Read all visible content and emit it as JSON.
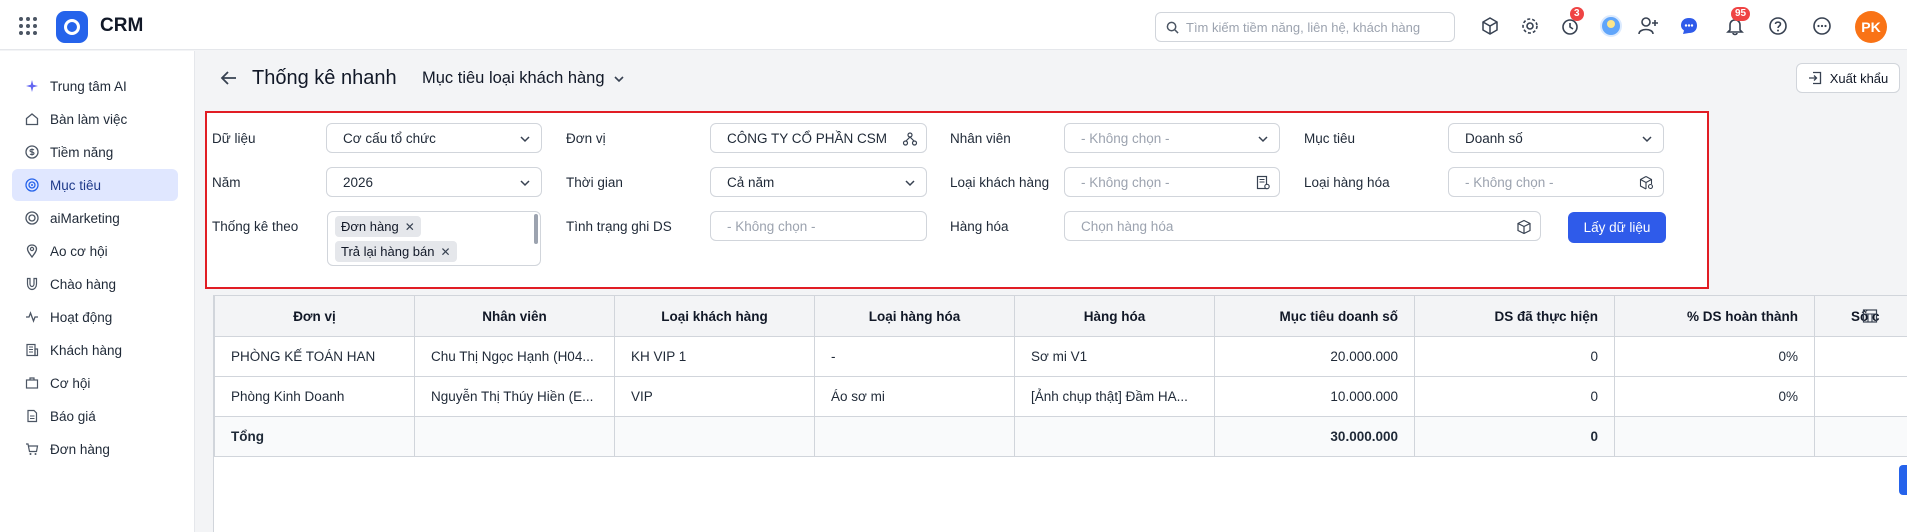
{
  "app": {
    "name": "CRM"
  },
  "search": {
    "placeholder": "Tìm kiếm tiềm năng, liên hệ, khách hàng"
  },
  "topbar": {
    "reminder_badge": "3",
    "notification_badge": "95",
    "user_initials": "PK"
  },
  "sidebar": {
    "items": [
      {
        "label": "Trung tâm AI",
        "icon": "sparkle-icon"
      },
      {
        "label": "Bàn làm việc",
        "icon": "home-icon"
      },
      {
        "label": "Tiềm năng",
        "icon": "dollar-icon"
      },
      {
        "label": "Mục tiêu",
        "icon": "target-icon",
        "active": true
      },
      {
        "label": "aiMarketing",
        "icon": "target-ring-icon"
      },
      {
        "label": "Ao cơ hội",
        "icon": "pin-icon"
      },
      {
        "label": "Chào hàng",
        "icon": "magnet-icon"
      },
      {
        "label": "Hoạt động",
        "icon": "activity-icon"
      },
      {
        "label": "Khách hàng",
        "icon": "building-icon"
      },
      {
        "label": "Cơ hội",
        "icon": "briefcase-icon"
      },
      {
        "label": "Báo giá",
        "icon": "document-icon"
      },
      {
        "label": "Đơn hàng",
        "icon": "cart-icon"
      }
    ]
  },
  "header": {
    "title": "Thống kê nhanh",
    "report_select": "Mục tiêu loại khách hàng",
    "export_label": "Xuất khẩu"
  },
  "filters": {
    "data_label": "Dữ liệu",
    "data_value": "Cơ cấu tổ chức",
    "unit_label": "Đơn vị",
    "unit_value": "CÔNG TY CỔ PHẦN CSM",
    "employee_label": "Nhân viên",
    "employee_placeholder": "- Không chọn -",
    "target_label": "Mục tiêu",
    "target_value": "Doanh số",
    "year_label": "Năm",
    "year_value": "2026",
    "time_label": "Thời gian",
    "time_value": "Cả năm",
    "customer_type_label": "Loại khách hàng",
    "customer_type_placeholder": "- Không chọn -",
    "product_type_label": "Loại hàng hóa",
    "product_type_placeholder": "- Không chọn -",
    "stat_by_label": "Thống kê theo",
    "stat_by_tags": [
      "Đơn hàng",
      "Trả lại hàng bán"
    ],
    "record_status_label": "Tình trạng ghi DS",
    "record_status_placeholder": "- Không chọn -",
    "product_label": "Hàng hóa",
    "product_placeholder": "Chọn hàng hóa",
    "get_data_label": "Lấy dữ liệu"
  },
  "table": {
    "columns": [
      "Đơn vị",
      "Nhân viên",
      "Loại khách hàng",
      "Loại hàng hóa",
      "Hàng hóa",
      "Mục tiêu doanh số",
      "DS đã thực hiện",
      "% DS hoàn thành",
      "Số c"
    ],
    "rows": [
      [
        "PHÒNG KẾ TOÁN HAN",
        "Chu Thị Ngọc Hạnh (H04...",
        "KH VIP 1",
        "-",
        "Sơ mi V1",
        "20.000.000",
        "0",
        "0%",
        ""
      ],
      [
        "Phòng Kinh Doanh",
        "Nguyễn Thị Thúy Hiền (E...",
        "VIP",
        "Áo sơ mi",
        "[Ảnh chụp thật] Đầm HA...",
        "10.000.000",
        "0",
        "0%",
        ""
      ]
    ],
    "total": [
      "Tổng",
      "",
      "",
      "",
      "",
      "30.000.000",
      "0",
      "",
      ""
    ]
  },
  "colors": {
    "accent": "#2f5bea",
    "highlight_border": "#e11d24",
    "active_nav_bg": "#e0e7ff"
  }
}
